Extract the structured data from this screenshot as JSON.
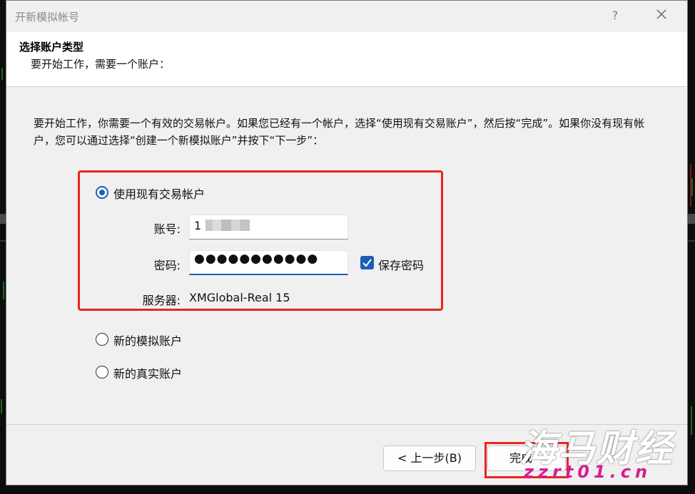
{
  "window": {
    "title": "开新模拟帐号",
    "help_label": "?"
  },
  "header": {
    "title": "选择账户类型",
    "subtitle": "要开始工作，需要一个账户："
  },
  "description": "要开始工作，你需要一个有效的交易帐户。如果您已经有一个帐户，选择“使用现有交易账户”，然后按“完成”。如果你没有现有帐户，您可以通过选择“创建一个新模拟账户”并按下“下一步”：",
  "options": {
    "existing": {
      "label": "使用现有交易帐户",
      "selected": true
    },
    "demo": {
      "label": "新的模拟账户",
      "selected": false
    },
    "real": {
      "label": "新的真实账户",
      "selected": false
    }
  },
  "form": {
    "account_label": "账号:",
    "account_value": "1",
    "password_label": "密码:",
    "password_value": "●●●●●●●●●●●",
    "save_password_label": "保存密码",
    "save_password_checked": true,
    "server_label": "服务器:",
    "server_value": "XMGlobal-Real 15"
  },
  "buttons": {
    "back": "< 上一步(B)",
    "finish": "完成"
  },
  "watermark": {
    "brand": "海马财经",
    "domain": "zzrt01.cn"
  },
  "colors": {
    "accent": "#1a5fb4",
    "highlight": "#e8261f",
    "watermark_pink": "#d61f8f"
  }
}
